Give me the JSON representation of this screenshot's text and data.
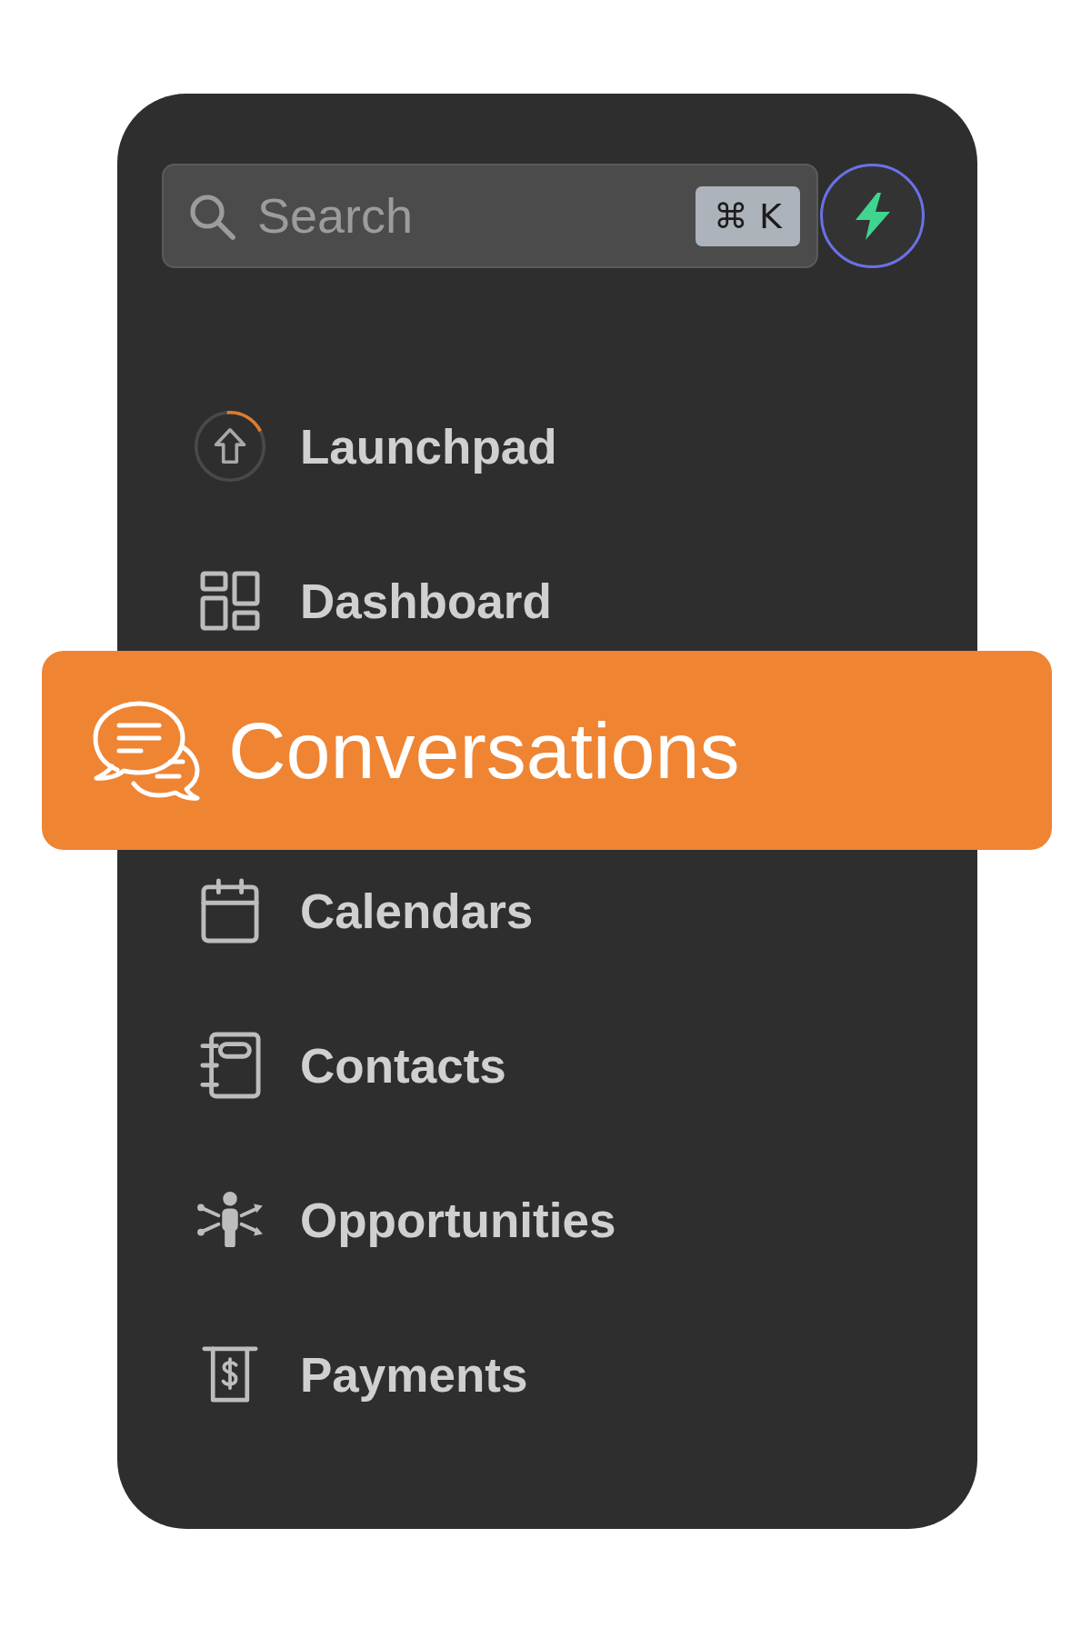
{
  "search": {
    "placeholder": "Search",
    "shortcut": "⌘ K"
  },
  "nav_items": [
    {
      "label": "Launchpad",
      "selected": false,
      "level": 0.19
    },
    {
      "label": "Dashboard",
      "selected": false
    },
    {
      "label": "Conversations",
      "selected": true
    },
    {
      "label": "Calendars",
      "selected": false
    },
    {
      "label": "Contacts",
      "selected": false
    },
    {
      "label": "Opportunities",
      "selected": false
    },
    {
      "label": "Payments",
      "selected": false
    }
  ]
}
